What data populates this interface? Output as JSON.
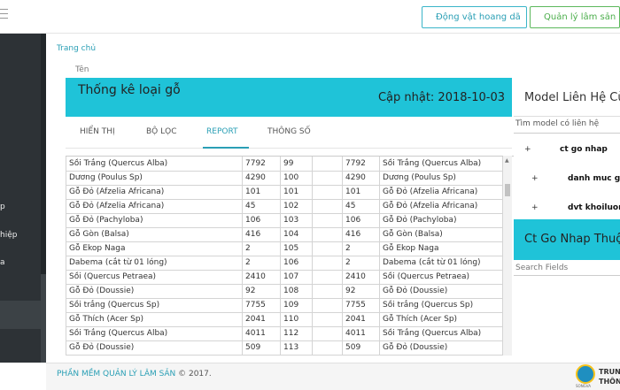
{
  "topbar": {
    "btn_wildlife": "Động vật hoang dã",
    "btn_forestry": "Quản lý lâm sản"
  },
  "sidebar": {
    "items": [
      {
        "label": "p"
      },
      {
        "label": "hiệp"
      },
      {
        "label": "a"
      }
    ],
    "collapse_icon": "chevron-left-icon"
  },
  "breadcrumb": "Trang chủ",
  "field_label": "Tên",
  "report": {
    "title": "Thống kê loại gỗ",
    "updated": "Cập nhật: 2018-10-03",
    "tabs": [
      {
        "label": "HIỂN THỊ"
      },
      {
        "label": "BỘ LỌC"
      },
      {
        "label": "REPORT"
      },
      {
        "label": "THÔNG SỐ"
      }
    ],
    "active_tab": "REPORT",
    "rows": [
      [
        "Sồi Trắng (Quercus Alba)",
        "7792",
        "99",
        "",
        "7792",
        "Sồi Trắng (Quercus Alba)"
      ],
      [
        "Dương (Poulus Sp)",
        "4290",
        "100",
        "",
        "4290",
        "Dương (Poulus Sp)"
      ],
      [
        "Gỗ Đỏ (Afzelia Africana)",
        "101",
        "101",
        "",
        "101",
        "Gỗ Đỏ (Afzelia Africana)"
      ],
      [
        "Gỗ Đỏ (Afzelia Africana)",
        "45",
        "102",
        "",
        "45",
        "Gỗ Đỏ (Afzelia Africana)"
      ],
      [
        "Gỗ Đỏ (Pachyloba)",
        "106",
        "103",
        "",
        "106",
        "Gỗ Đỏ (Pachyloba)"
      ],
      [
        "Gỗ Gòn (Balsa)",
        "416",
        "104",
        "",
        "416",
        "Gỗ Gòn (Balsa)"
      ],
      [
        "Gỗ Ekop Naga",
        "2",
        "105",
        "",
        "2",
        "Gỗ Ekop Naga"
      ],
      [
        "Dabema (cắt từ 01 lóng)",
        "2",
        "106",
        "",
        "2",
        "Dabema (cắt từ 01 lóng)"
      ],
      [
        "Sồi (Quercus Petraea)",
        "2410",
        "107",
        "",
        "2410",
        "Sồi (Quercus Petraea)"
      ],
      [
        "Gỗ Đỏ (Doussie)",
        "92",
        "108",
        "",
        "92",
        "Gỗ Đỏ (Doussie)"
      ],
      [
        "Sồi trắng (Quercus Sp)",
        "7755",
        "109",
        "",
        "7755",
        "Sồi trắng (Quercus Sp)"
      ],
      [
        "Gỗ Thích (Acer Sp)",
        "2041",
        "110",
        "",
        "2041",
        "Gỗ Thích (Acer Sp)"
      ],
      [
        "Sồi Trắng (Quercus Alba)",
        "4011",
        "112",
        "",
        "4011",
        "Sồi Trắng (Quercus Alba)"
      ],
      [
        "Gỗ Đỏ (Doussie)",
        "509",
        "113",
        "",
        "509",
        "Gỗ Đỏ (Doussie)"
      ]
    ]
  },
  "model_panel": {
    "title": "Model Liên Hệ Cù",
    "search_placeholder": "Tìm model có liên hệ",
    "tree": [
      {
        "label": "ct go nhap"
      },
      {
        "label": "danh muc go"
      },
      {
        "label": "dvt khoiluon"
      }
    ]
  },
  "ct_panel": {
    "title": "Ct Go Nhap Thuộ",
    "search_placeholder": "Search Fields"
  },
  "footer": {
    "brand": "PHẦN MỀM QUẢN LÝ LÂM SẢN",
    "copyright": "© 2017.",
    "logo_text_1": "TRUN",
    "logo_text_2": "THÔN",
    "logo_sub": "SONGVA"
  },
  "colors": {
    "accent": "#1fc3d8",
    "link": "#2a9fb5",
    "sidebar": "#2d3236",
    "green": "#5cb85c"
  }
}
